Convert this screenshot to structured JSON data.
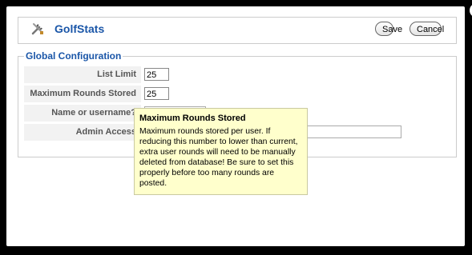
{
  "header": {
    "icon": "tools-icon",
    "title": "GolfStats",
    "save_label": "Save",
    "cancel_label": "Cancel"
  },
  "config": {
    "legend": "Global Configuration",
    "rows": [
      {
        "label": "List Limit",
        "value": "25"
      },
      {
        "label": "Maximum Rounds Stored",
        "value": "25"
      },
      {
        "label": "Name or username?",
        "value": ""
      },
      {
        "label": "Admin Access",
        "value": ""
      }
    ]
  },
  "tooltip": {
    "title": "Maximum Rounds Stored",
    "text": "Maximum rounds stored per user. If reducing this number to lower than current, extra user rounds will need to be manually deleted from database! Be sure to set this properly before too many rounds are posted."
  },
  "colors": {
    "accent": "#1a56a8",
    "tooltip_bg": "#ffffcc",
    "backdrop": "#000000"
  }
}
